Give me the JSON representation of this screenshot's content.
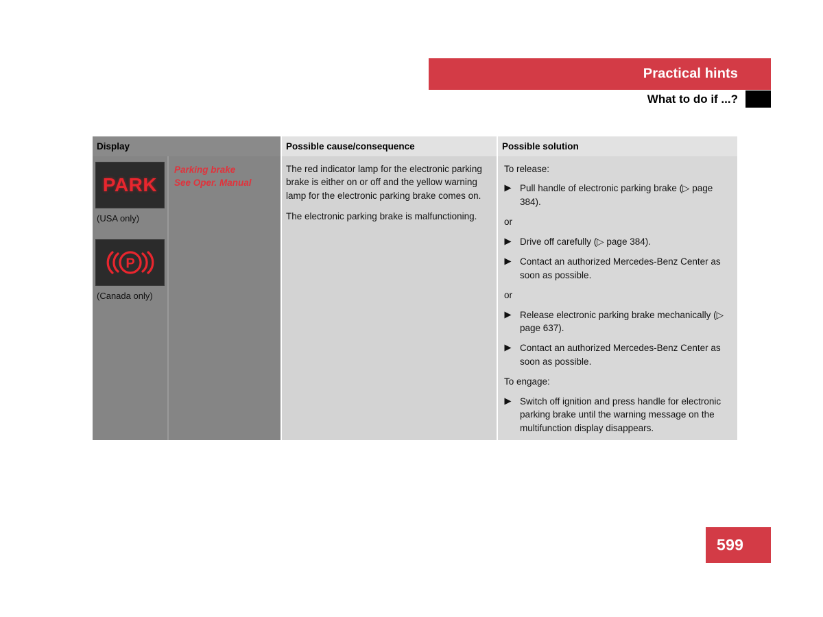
{
  "header": {
    "section_title": "Practical hints",
    "page_title": "What to do if ...?"
  },
  "table": {
    "columns": [
      {
        "key": "display",
        "label": "Display"
      },
      {
        "key": "cause",
        "label": "Possible cause/consequence"
      },
      {
        "key": "solution",
        "label": "Possible solution"
      }
    ],
    "rows": [
      {
        "display": {
          "lamps": [
            {
              "icon": "park-text-lamp-icon",
              "text": "PARK",
              "caption": "(USA only)"
            },
            {
              "icon": "parking-brake-lamp-icon",
              "text": "",
              "caption": "(Canada only)"
            }
          ],
          "message_lines": [
            "Parking brake",
            "See Oper. Manual"
          ]
        },
        "cause": [
          "The red indicator lamp for the electronic parking brake is either on or off and the yellow warning lamp for the electronic parking brake comes on.",
          "The electronic parking brake is malfunctioning."
        ],
        "solution": [
          {
            "type": "label",
            "text": "To release:"
          },
          {
            "type": "bullet",
            "text": "Pull handle of electronic parking brake (▷ page 384)."
          },
          {
            "type": "or",
            "text": "or"
          },
          {
            "type": "bullet",
            "text": "Drive off carefully (▷ page 384)."
          },
          {
            "type": "bullet",
            "text": "Contact an authorized Mercedes-Benz Center as soon as possible."
          },
          {
            "type": "or",
            "text": "or"
          },
          {
            "type": "bullet",
            "text": "Release electronic parking brake mechanically (▷ page 637)."
          },
          {
            "type": "bullet",
            "text": "Contact an authorized Mercedes-Benz Center as soon as possible."
          },
          {
            "type": "label",
            "text": "To engage:"
          },
          {
            "type": "bullet",
            "text": "Switch off ignition and press handle for electronic parking brake until the warning message on the multifunction display disappears."
          }
        ]
      }
    ]
  },
  "footer": {
    "page_number": "599"
  },
  "colors": {
    "accent_red": "#d33b46",
    "lamp_red": "#e8262e",
    "message_red": "#e0333c",
    "header_dark_gray": "#8a8a8a",
    "header_light_gray": "#e2e2e2",
    "cell_dark_gray": "#858585",
    "cell_light_gray": "#d3d3d3",
    "cell_solution_gray": "#d8d8d8",
    "lamp_background": "#2b2b2b"
  }
}
